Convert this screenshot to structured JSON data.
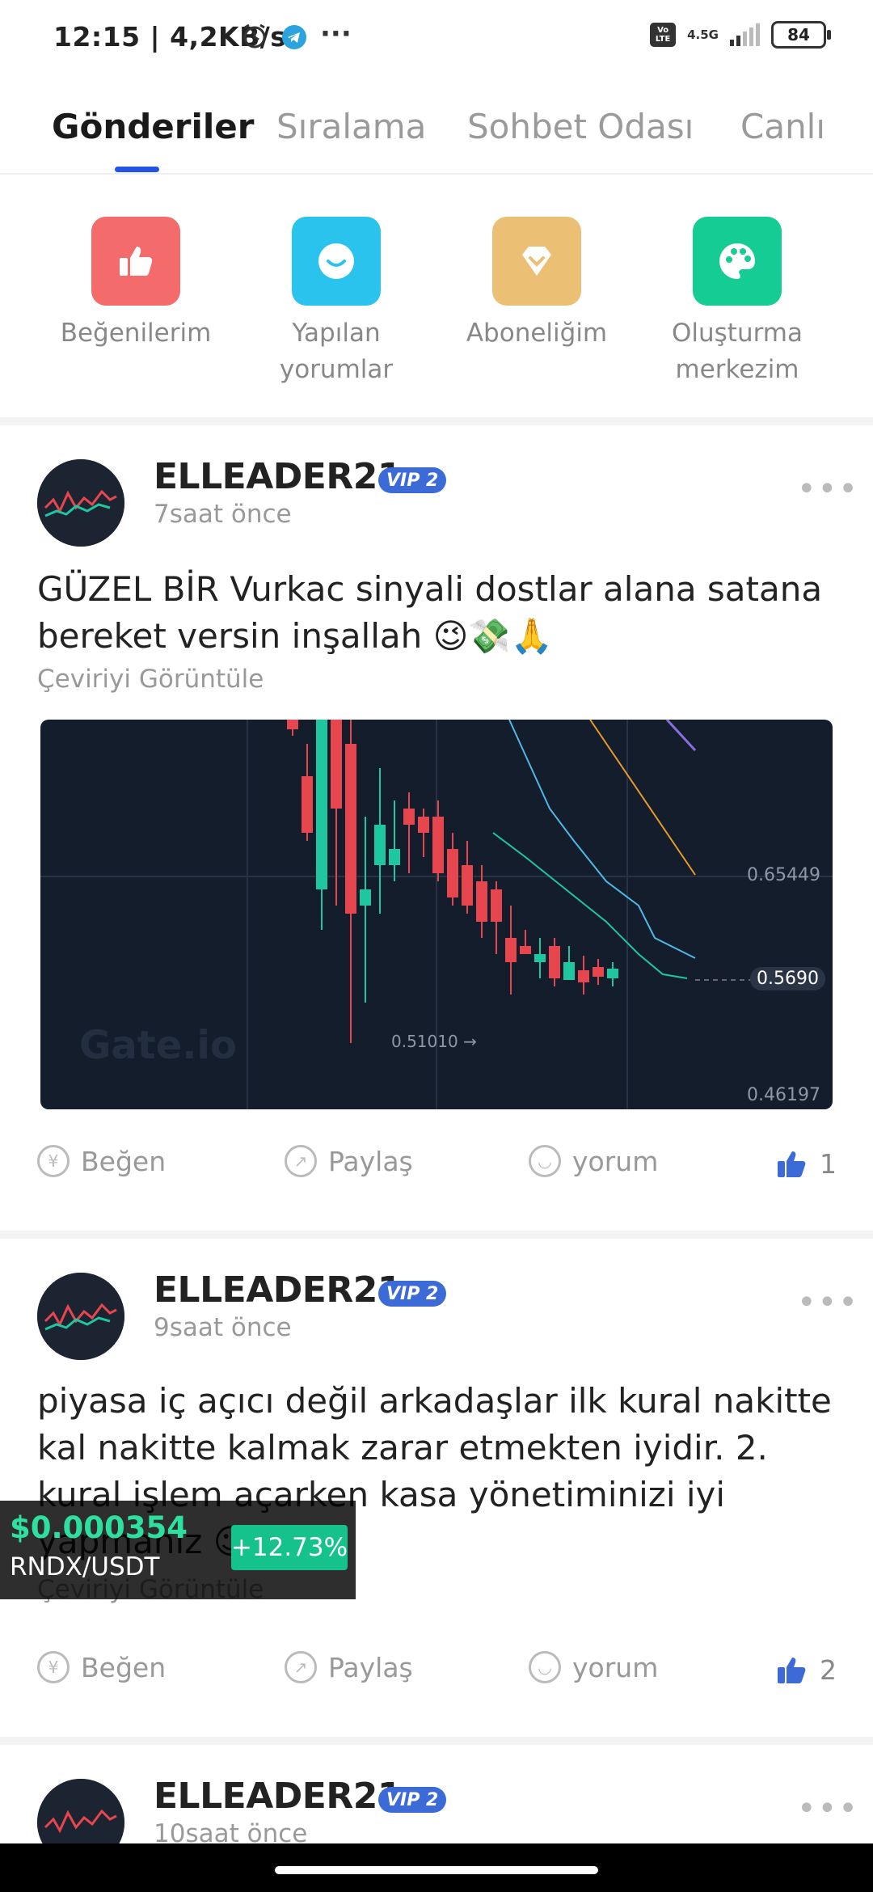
{
  "status": {
    "time": "12:15 | 4,2KB/s",
    "network": "4.5G",
    "battery": "84",
    "volte": "Vo LTE"
  },
  "tabs": [
    {
      "label": "Gönderiler",
      "active": true
    },
    {
      "label": "Sıralama",
      "active": false
    },
    {
      "label": "Sohbet Odası",
      "active": false
    },
    {
      "label": "Canlı",
      "active": false
    }
  ],
  "quick_actions": [
    {
      "label": "Beğenilerim",
      "icon": "thumbs-up-icon",
      "color": "#f46b6b"
    },
    {
      "label": "Yapılan yorumlar",
      "icon": "comment-icon",
      "color": "#29c3ee"
    },
    {
      "label": "Aboneliğim",
      "icon": "diamond-icon",
      "color": "#ecc074"
    },
    {
      "label": "Oluşturma merkezim",
      "icon": "palette-icon",
      "color": "#14cc94"
    }
  ],
  "posts": [
    {
      "username": "ELLEADER21",
      "vip": "VIP 2",
      "time": "7saat önce",
      "text": "GÜZEL BİR Vurkac sinyali dostlar alana satana bereket versin inşallah 😉💸🙏",
      "translate": "Çeviriyi Görüntüle",
      "like_label": "Beğen",
      "share_label": "Paylaş",
      "comment_label": "yorum",
      "likes": "1"
    },
    {
      "username": "ELLEADER21",
      "vip": "VIP 2",
      "time": "9saat önce",
      "text": "piyasa iç açıcı değil arkadaşlar ilk kural nakitte kal nakitte kalmak zarar etmekten iyidir. 2. kural işlem açarken kasa yönetiminizi iyi yapmanız 😉",
      "translate": "Çeviriyi Görüntüle",
      "like_label": "Beğen",
      "share_label": "Paylaş",
      "comment_label": "yorum",
      "likes": "2"
    },
    {
      "username": "ELLEADER21",
      "vip": "VIP 2",
      "time": "10saat önce"
    }
  ],
  "chart": {
    "price_labels": [
      "0.65449",
      "0.5690",
      "0.46197"
    ],
    "low_label": "0.51010",
    "watermark": "Gate.io",
    "colors": {
      "up": "#1fc7a0",
      "down": "#e8464e",
      "bg": "#131d2c"
    }
  },
  "ticker": {
    "price": "$0.000354",
    "pair": "RNDX/USDT",
    "change": "+12.73%"
  }
}
